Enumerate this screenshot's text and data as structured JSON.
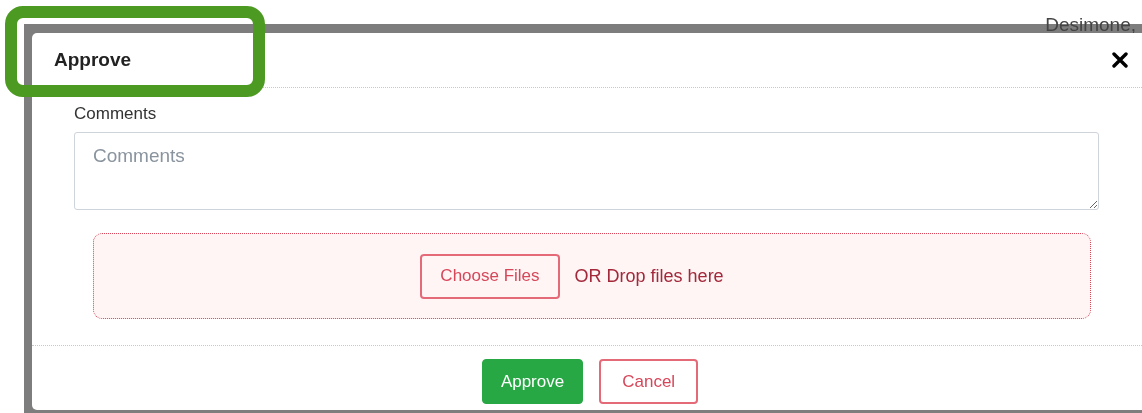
{
  "background": {
    "text": "Desimone,"
  },
  "dialog": {
    "title": "Approve",
    "comments": {
      "label": "Comments",
      "placeholder": "Comments"
    },
    "upload": {
      "button": "Choose Files",
      "hint": "OR Drop files here"
    },
    "buttons": [
      {
        "label": "Approve",
        "kind": "primary"
      },
      {
        "label": "Cancel",
        "kind": "secondary"
      }
    ]
  }
}
